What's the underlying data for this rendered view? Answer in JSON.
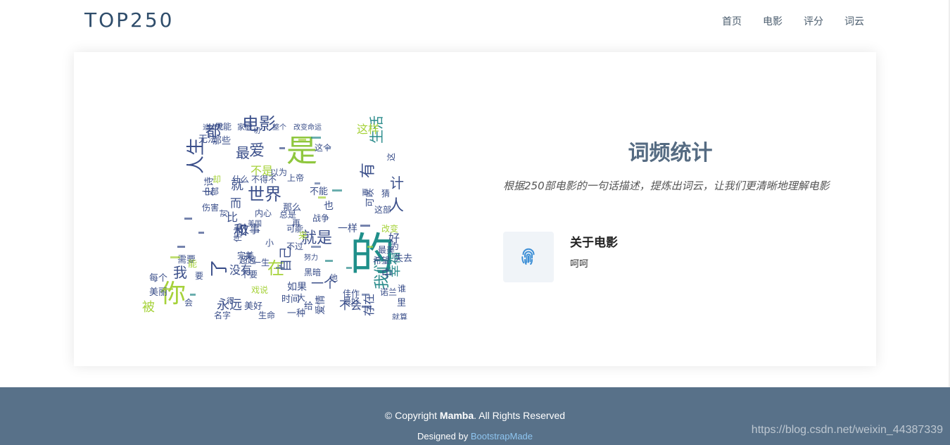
{
  "header": {
    "logo": "TOP250",
    "nav": [
      {
        "label": "首页"
      },
      {
        "label": "电影"
      },
      {
        "label": "评分"
      },
      {
        "label": "词云"
      }
    ]
  },
  "section": {
    "title": "词频统计",
    "description": "根据250部电影的一句话描述，提炼出词云，让我们更清晰地理解电影",
    "feature": {
      "icon": "fingerprint-icon",
      "title": "关于电影",
      "text": "呵呵"
    }
  },
  "wordcloud": {
    "words": [
      {
        "t": "的",
        "c": "#1f8f8a"
      },
      {
        "t": "是",
        "c": "#8fc73e"
      },
      {
        "t": "你",
        "c": "#a6d23a"
      },
      {
        "t": "人生",
        "c": "#3b4f8a"
      },
      {
        "t": "电影",
        "c": "#3b4f8a"
      },
      {
        "t": "世界",
        "c": "#3b4f8a"
      },
      {
        "t": "我们",
        "c": "#2c8c8c"
      },
      {
        "t": "人",
        "c": "#3b4f8a"
      },
      {
        "t": "就是",
        "c": "#3b4f8a"
      },
      {
        "t": "了",
        "c": "#3b4f8a"
      },
      {
        "t": "在",
        "c": "#a6d23a"
      },
      {
        "t": "都",
        "c": "#3b4f8a"
      },
      {
        "t": "最",
        "c": "#3b4f8a"
      },
      {
        "t": "爱",
        "c": "#3b4f8a"
      },
      {
        "t": "有",
        "c": "#3b4f8a"
      },
      {
        "t": "生活",
        "c": "#2c8c8c"
      },
      {
        "t": "这样",
        "c": "#a6d23a"
      },
      {
        "t": "计",
        "c": "#3b4f8a"
      },
      {
        "t": "和",
        "c": "#3b4f8a"
      },
      {
        "t": "永远",
        "c": "#3b4f8a"
      },
      {
        "t": "不会",
        "c": "#3b4f8a"
      },
      {
        "t": "被",
        "c": "#a6d23a"
      },
      {
        "t": "我",
        "c": "#3b4f8a"
      },
      {
        "t": "自己",
        "c": "#3b4f8a"
      },
      {
        "t": "没有",
        "c": "#3b4f8a"
      },
      {
        "t": "一个",
        "c": "#3b4f8a"
      },
      {
        "t": "不是",
        "c": "#a6d23a"
      },
      {
        "t": "故事",
        "c": "#3b4f8a"
      },
      {
        "t": "就",
        "c": "#3b4f8a"
      },
      {
        "t": "而",
        "c": "#3b4f8a"
      },
      {
        "t": "比",
        "c": "#3b4f8a"
      },
      {
        "t": "存在",
        "c": "#3b4f8a"
      },
      {
        "t": "中",
        "c": "#3b4f8a"
      },
      {
        "t": "幸福",
        "c": "#2c8c8c"
      },
      {
        "t": "好",
        "c": "#3b4f8a"
      },
      {
        "t": "失去",
        "c": "#3b4f8a"
      },
      {
        "t": "美丽",
        "c": "#3b4f8a"
      },
      {
        "t": "孤独",
        "c": "#3b4f8a"
      },
      {
        "t": "每个",
        "c": "#3b4f8a"
      },
      {
        "t": "需要",
        "c": "#3b4f8a"
      },
      {
        "t": "能",
        "c": "#a6d23a"
      },
      {
        "t": "美好",
        "c": "#3b4f8a"
      },
      {
        "t": "生命",
        "c": "#3b4f8a"
      },
      {
        "t": "名字",
        "c": "#3b4f8a"
      },
      {
        "t": "一种",
        "c": "#3b4f8a"
      },
      {
        "t": "时间",
        "c": "#3b4f8a"
      },
      {
        "t": "给",
        "c": "#3b4f8a"
      },
      {
        "t": "爱情",
        "c": "#3b4f8a"
      },
      {
        "t": "如果",
        "c": "#3b4f8a"
      },
      {
        "t": "里",
        "c": "#3b4f8a"
      },
      {
        "t": "谁",
        "c": "#3b4f8a"
      },
      {
        "t": "可以",
        "c": "#3b4f8a"
      },
      {
        "t": "不能",
        "c": "#3b4f8a"
      },
      {
        "t": "一样",
        "c": "#3b4f8a"
      },
      {
        "t": "那么",
        "c": "#3b4f8a"
      },
      {
        "t": "无法",
        "c": "#3b4f8a"
      },
      {
        "t": "那些",
        "c": "#3b4f8a"
      },
      {
        "t": "只能",
        "c": "#3b4f8a"
      },
      {
        "t": "家庭",
        "c": "#3b4f8a"
      },
      {
        "t": "迪士尼",
        "c": "#3b4f8a"
      },
      {
        "t": "整个",
        "c": "#3b4f8a"
      },
      {
        "t": "改变命运",
        "c": "#3b4f8a"
      },
      {
        "t": "这个",
        "c": "#3b4f8a"
      },
      {
        "t": "上帝",
        "c": "#3b4f8a"
      },
      {
        "t": "战争",
        "c": "#3b4f8a"
      },
      {
        "t": "也",
        "c": "#3b4f8a"
      },
      {
        "t": "史诗",
        "c": "#3b4f8a"
      },
      {
        "t": "什么",
        "c": "#3b4f8a"
      },
      {
        "t": "对",
        "c": "#3b4f8a"
      },
      {
        "t": "伤害",
        "c": "#3b4f8a"
      },
      {
        "t": "内心",
        "c": "#3b4f8a"
      },
      {
        "t": "总是",
        "c": "#3b4f8a"
      },
      {
        "t": "再",
        "c": "#3b4f8a"
      },
      {
        "t": "美国",
        "c": "#3b4f8a"
      },
      {
        "t": "可能",
        "c": "#3b4f8a"
      },
      {
        "t": "来",
        "c": "#a6d23a"
      },
      {
        "t": "伟大",
        "c": "#3b4f8a"
      },
      {
        "t": "小",
        "c": "#3b4f8a"
      },
      {
        "t": "不过",
        "c": "#3b4f8a"
      },
      {
        "t": "完美",
        "c": "#3b4f8a"
      },
      {
        "t": "天",
        "c": "#3b4f8a"
      },
      {
        "t": "一生",
        "c": "#3b4f8a"
      },
      {
        "t": "不要",
        "c": "#3b4f8a"
      },
      {
        "t": "要",
        "c": "#3b4f8a"
      },
      {
        "t": "黑暗",
        "c": "#3b4f8a"
      },
      {
        "t": "改变",
        "c": "#a6d23a"
      },
      {
        "t": "最美",
        "c": "#3b4f8a"
      },
      {
        "t": "希望",
        "c": "#3b4f8a"
      },
      {
        "t": "诺兰",
        "c": "#3b4f8a"
      },
      {
        "t": "为",
        "c": "#3b4f8a"
      },
      {
        "t": "猜",
        "c": "#3b4f8a"
      },
      {
        "t": "这部",
        "c": "#3b4f8a"
      },
      {
        "t": "更",
        "c": "#3b4f8a"
      },
      {
        "t": "得",
        "c": "#3b4f8a"
      },
      {
        "t": "戏说",
        "c": "#a6d23a"
      },
      {
        "t": "大",
        "c": "#3b4f8a"
      },
      {
        "t": "佳作",
        "c": "#3b4f8a"
      },
      {
        "t": "就算",
        "c": "#3b4f8a"
      },
      {
        "t": "不得不",
        "c": "#3b4f8a"
      },
      {
        "t": "却",
        "c": "#a6d23a"
      },
      {
        "t": "以为",
        "c": "#3b4f8a"
      },
      {
        "t": "一部",
        "c": "#3b4f8a"
      },
      {
        "t": "会",
        "c": "#3b4f8a"
      },
      {
        "t": "超越",
        "c": "#3b4f8a"
      },
      {
        "t": "努力",
        "c": "#3b4f8a"
      },
      {
        "t": "一切",
        "c": "#3b4f8a"
      },
      {
        "t": "最好",
        "c": "#3b4f8a"
      },
      {
        "t": "这",
        "c": "#3b4f8a"
      },
      {
        "t": "他",
        "c": "#3b4f8a"
      },
      {
        "t": "我们",
        "c": "#3b4f8a"
      }
    ]
  },
  "footer": {
    "copyright_prefix": "© Copyright ",
    "copyright_brand": "Mamba",
    "copyright_suffix": ". All Rights Reserved",
    "designed_by": "Designed by ",
    "designer_link": "BootstrapMade",
    "watermark": "https://blog.csdn.net/weixin_44387339"
  }
}
